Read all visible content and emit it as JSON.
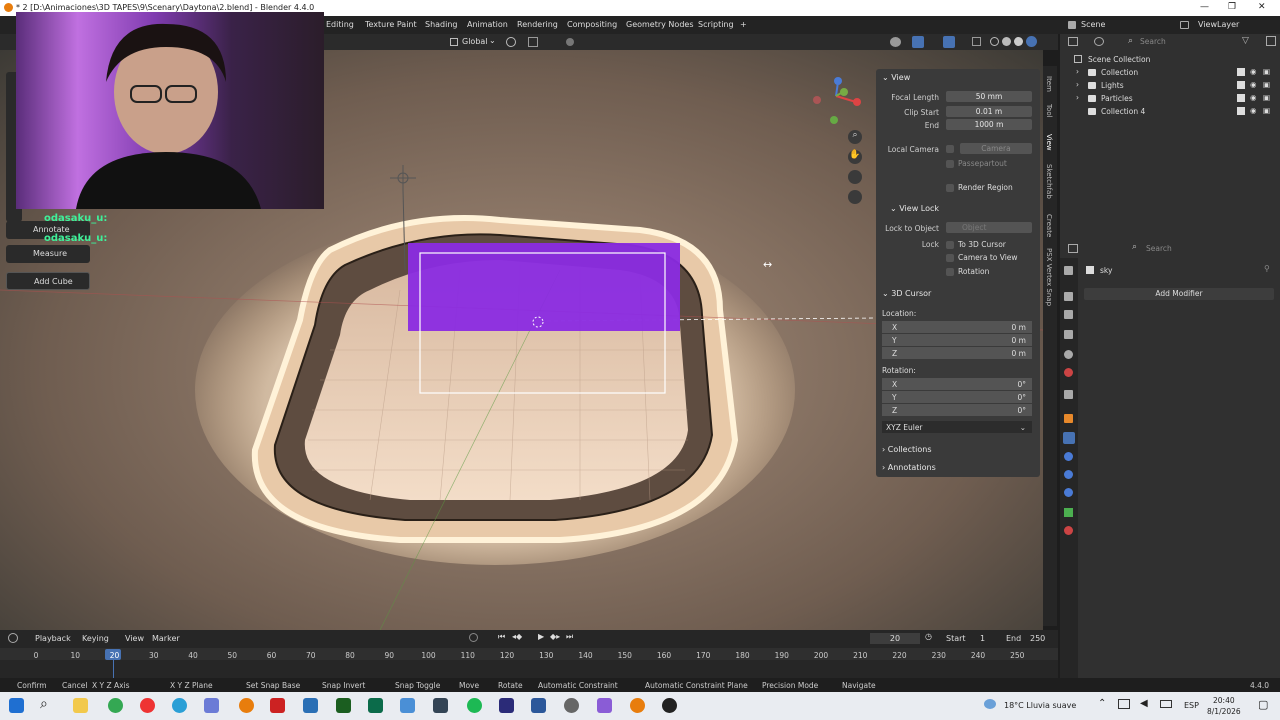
{
  "titlebar": {
    "title": "* 2 [D:\\Animaciones\\3D TAPES\\9\\Scenary\\Daytona\\2.blend] - Blender 4.4.0"
  },
  "workspaces": [
    "Editing",
    "Texture Paint",
    "Shading",
    "Animation",
    "Rendering",
    "Compositing",
    "Geometry Nodes",
    "Scripting",
    "+"
  ],
  "topright": {
    "scene": "Scene",
    "viewlayer": "ViewLayer"
  },
  "header": {
    "orientation": "Global"
  },
  "tools": [
    "Annotate",
    "Measure",
    "Add Cube"
  ],
  "chat": [
    "odasaku_u:",
    "odasaku_u:"
  ],
  "npanel": {
    "view_title": "View",
    "focal_label": "Focal Length",
    "focal_value": "50 mm",
    "clip_start_label": "Clip Start",
    "clip_start_value": "0.01 m",
    "end_label": "End",
    "end_value": "1000 m",
    "local_camera_label": "Local Camera",
    "camera_value": "Camera",
    "passepartout": "Passepartout",
    "render_region": "Render Region",
    "view_lock_title": "View Lock",
    "lock_to_object_label": "Lock to Object",
    "object_placeholder": "Object",
    "lock_label": "Lock",
    "to_3d_cursor": "To 3D Cursor",
    "camera_to_view": "Camera to View",
    "rotation_opt": "Rotation",
    "cursor_title": "3D Cursor",
    "location_label": "Location:",
    "loc": [
      {
        "k": "X",
        "v": "0 m"
      },
      {
        "k": "Y",
        "v": "0 m"
      },
      {
        "k": "Z",
        "v": "0 m"
      }
    ],
    "rotation_label": "Rotation:",
    "rot": [
      {
        "k": "X",
        "v": "0°"
      },
      {
        "k": "Y",
        "v": "0°"
      },
      {
        "k": "Z",
        "v": "0°"
      }
    ],
    "euler": "XYZ Euler",
    "collections": "Collections",
    "annotations": "Annotations"
  },
  "vtabs": [
    "Item",
    "Tool",
    "View",
    "Sketchfab",
    "Create",
    "PSX Vertex Snap"
  ],
  "outliner": {
    "search": "Search",
    "root": "Scene Collection",
    "items": [
      "Collection",
      "Lights",
      "Particles",
      "Collection 4"
    ]
  },
  "props": {
    "search": "Search",
    "object": "sky",
    "add_modifier": "Add Modifier"
  },
  "timeline": {
    "playback": "Playback",
    "keying": "Keying",
    "view": "View",
    "marker": "Marker",
    "current": "20",
    "start_label": "Start",
    "start": "1",
    "end_label": "End",
    "end": "250",
    "frames": [
      "0",
      "10",
      "20",
      "30",
      "40",
      "50",
      "60",
      "70",
      "80",
      "90",
      "100",
      "110",
      "120",
      "130",
      "140",
      "150",
      "160",
      "170",
      "180",
      "190",
      "200",
      "210",
      "220",
      "230",
      "240",
      "250"
    ]
  },
  "status": {
    "items": [
      "Confirm",
      "Cancel",
      "X Y Z Axis",
      "X Y Z Plane",
      "Set Snap Base",
      "Snap Invert",
      "Snap Toggle",
      "Move",
      "Rotate",
      "Automatic Constraint",
      "Automatic Constraint Plane",
      "Precision Mode",
      "Navigate"
    ],
    "version": "4.4.0"
  },
  "taskbar": {
    "weather": "18°C Lluvia suave",
    "lang": "ESP",
    "time": "20:40",
    "date": "8/1/2026"
  },
  "colors": {
    "accent": "#4772b3",
    "purple": "#8a2be2"
  }
}
